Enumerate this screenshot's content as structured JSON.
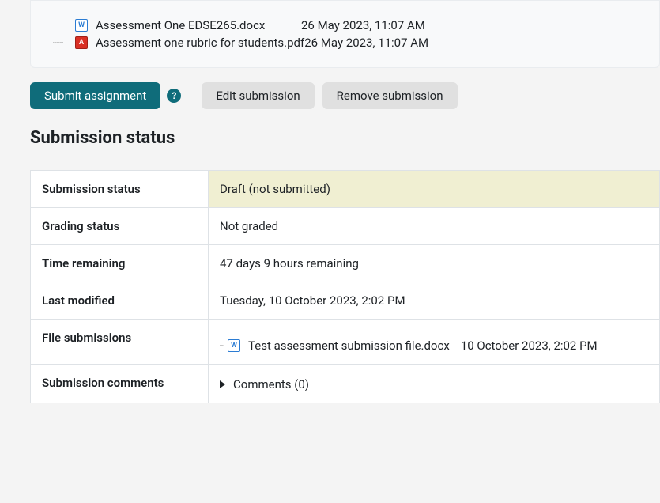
{
  "files_box": {
    "items": [
      {
        "icon": "word",
        "name": "Assessment One EDSE265.docx",
        "date": "26 May 2023, 11:07 AM",
        "compress": false
      },
      {
        "icon": "pdf",
        "name": "Assessment one rubric for students.pdf",
        "date": "26 May 2023, 11:07 AM",
        "compress": true
      }
    ]
  },
  "actions": {
    "submit": "Submit assignment",
    "edit": "Edit submission",
    "remove": "Remove submission"
  },
  "section_title": "Submission status",
  "table": {
    "rows": {
      "submission_status": {
        "label": "Submission status",
        "value": "Draft (not submitted)"
      },
      "grading_status": {
        "label": "Grading status",
        "value": "Not graded"
      },
      "time_remaining": {
        "label": "Time remaining",
        "value": "47 days 9 hours remaining"
      },
      "last_modified": {
        "label": "Last modified",
        "value": "Tuesday, 10 October 2023, 2:02 PM"
      },
      "file_submissions": {
        "label": "File submissions",
        "file_name": "Test assessment submission file.docx",
        "file_date": "10 October 2023, 2:02 PM"
      },
      "comments": {
        "label": "Submission comments",
        "value": "Comments (0)"
      }
    }
  }
}
